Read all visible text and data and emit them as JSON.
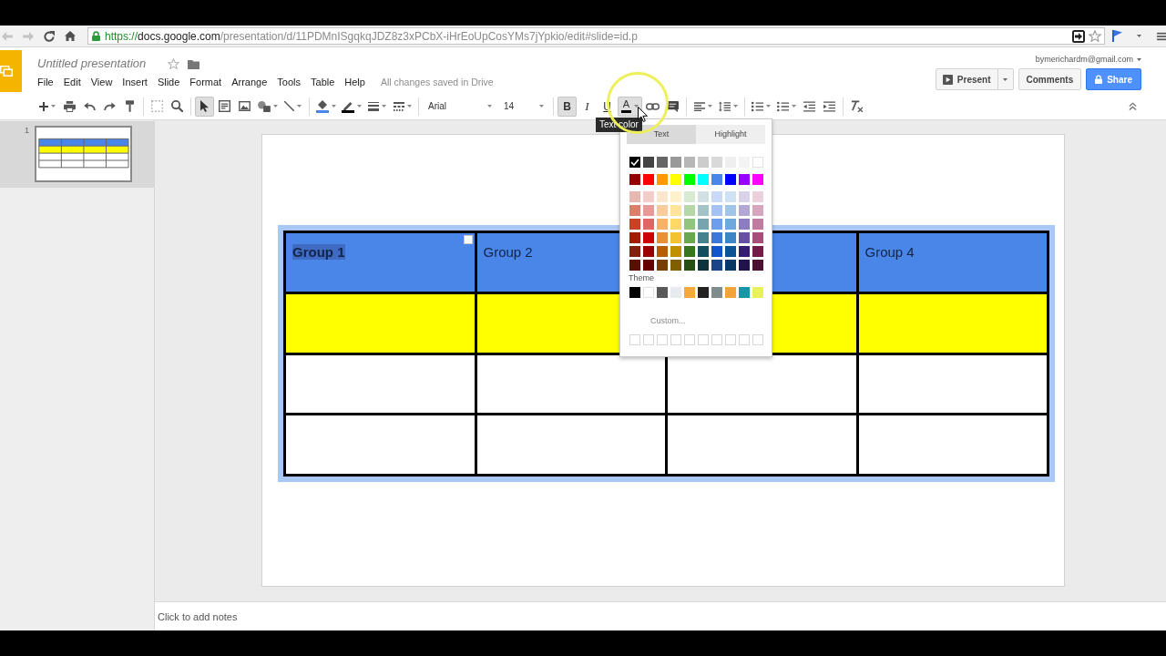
{
  "browser": {
    "nav": [
      {
        "kind": "back",
        "disabled": true
      },
      {
        "kind": "forward",
        "disabled": true
      },
      {
        "kind": "reload",
        "disabled": false
      },
      {
        "kind": "home",
        "disabled": false
      }
    ],
    "url": {
      "scheme": "https://",
      "host": "docs.google.com",
      "path": "/presentation/d/11PDMnISgqkqJDZ8z3xPCbX-iHrEoUpCosYMs7jYpkio/edit#slide=id.p"
    },
    "bookmarked": false
  },
  "app": {
    "title": "Untitled presentation",
    "starred": false,
    "menu": [
      "File",
      "Edit",
      "View",
      "Insert",
      "Slide",
      "Format",
      "Arrange",
      "Tools",
      "Table",
      "Help"
    ],
    "save_status": "All changes saved in Drive",
    "account": "bymerichardm@gmail.com",
    "buttons": [
      {
        "kind": "present",
        "label": "Present"
      },
      {
        "kind": "comments",
        "label": "Comments"
      },
      {
        "kind": "share",
        "label": "Share"
      }
    ]
  },
  "toolbar": {
    "groups": [
      {
        "items": [
          {
            "kind": "new",
            "on": false
          },
          {
            "kind": "print",
            "on": false
          },
          {
            "kind": "undo",
            "on": false
          },
          {
            "kind": "redo",
            "on": false
          },
          {
            "kind": "paint-format",
            "on": false
          }
        ]
      },
      {
        "items": [
          {
            "kind": "zoom-fit",
            "on": false
          },
          {
            "kind": "zoom",
            "on": false
          }
        ]
      },
      {
        "items": [
          {
            "kind": "select",
            "on": true
          },
          {
            "kind": "text-box",
            "on": false
          },
          {
            "kind": "image",
            "on": false
          },
          {
            "kind": "shape",
            "on": false
          },
          {
            "kind": "line",
            "on": false
          }
        ]
      },
      {
        "items": [
          {
            "kind": "fill-color",
            "on": false,
            "color": "#4a86e8"
          },
          {
            "kind": "line-color",
            "on": false,
            "color": "#000000"
          },
          {
            "kind": "line-weight",
            "on": false
          },
          {
            "kind": "line-dash",
            "on": false
          }
        ]
      },
      {
        "items": [
          {
            "kind": "font",
            "value": "Arial"
          },
          {
            "kind": "font-size",
            "value": "14"
          }
        ]
      },
      {
        "items": [
          {
            "kind": "bold",
            "label": "B",
            "on": true
          },
          {
            "kind": "italic",
            "label": "I",
            "on": false
          },
          {
            "kind": "underline",
            "label": "U",
            "on": false
          },
          {
            "kind": "text-color",
            "label": "A",
            "on": true,
            "color": "#000000"
          },
          {
            "kind": "link",
            "on": false
          },
          {
            "kind": "comment",
            "on": false
          }
        ]
      },
      {
        "items": [
          {
            "kind": "align",
            "on": false
          },
          {
            "kind": "line-spacing",
            "on": false
          }
        ]
      },
      {
        "items": [
          {
            "kind": "numbered-list",
            "on": false
          },
          {
            "kind": "bulleted-list",
            "on": false
          },
          {
            "kind": "decrease-indent",
            "on": false
          },
          {
            "kind": "increase-indent",
            "on": false
          }
        ]
      },
      {
        "items": [
          {
            "kind": "clear-formatting",
            "on": false
          }
        ]
      }
    ]
  },
  "tooltip": "Text color",
  "filmstrip": {
    "slides": [
      {
        "number": "1",
        "selected": true
      }
    ]
  },
  "table": {
    "rows": [
      {
        "color": "#4a86e8",
        "cells": [
          {
            "text": "Group 1",
            "bold": true,
            "selected": true
          },
          {
            "text": "Group 2",
            "bold": false,
            "selected": false
          },
          {
            "selected": false
          },
          {
            "text": "Group 4",
            "bold": false,
            "selected": false
          }
        ]
      },
      {
        "color": "#ffff00",
        "cells": [
          {
            "selected": false
          },
          {},
          {
            "selected": false
          },
          {
            "selected": false
          }
        ]
      },
      {
        "color": "#ffffff",
        "cells": [
          {
            "selected": false
          },
          {
            "selected": false
          },
          {
            "selected": false
          },
          {
            "selected": false
          }
        ]
      },
      {
        "color": "#ffffff",
        "cells": [
          {
            "selected": false
          },
          {
            "selected": false
          },
          {
            "selected": false
          },
          {
            "selected": false
          }
        ]
      }
    ]
  },
  "color_picker": {
    "tabs": [
      {
        "label": "Text",
        "selected": true
      },
      {
        "label": "Highlight",
        "selected": false
      }
    ],
    "grid": [
      {
        "swatches": [
          {
            "color": "#000000",
            "selected": true
          },
          {
            "color": "#434343",
            "selected": false
          },
          {
            "color": "#666666",
            "selected": false
          },
          {
            "color": "#999999",
            "selected": false
          },
          {
            "color": "#b7b7b7",
            "selected": false
          },
          {
            "color": "#cccccc",
            "selected": false
          },
          {
            "color": "#d9d9d9",
            "selected": false
          },
          {
            "color": "#efefef",
            "selected": false
          },
          {
            "color": "#f3f3f3",
            "selected": false
          },
          {
            "color": "#ffffff",
            "selected": false
          }
        ]
      },
      {
        "swatches": [
          {
            "color": "#980000",
            "selected": false
          },
          {
            "color": "#ff0000",
            "selected": false
          },
          {
            "color": "#ff9900",
            "selected": false
          },
          {
            "color": "#ffff00",
            "selected": false
          },
          {
            "color": "#00ff00",
            "selected": false
          },
          {
            "color": "#00ffff",
            "selected": false
          },
          {
            "color": "#4a86e8",
            "selected": false
          },
          {
            "color": "#0000ff",
            "selected": false
          },
          {
            "color": "#9900ff",
            "selected": false
          },
          {
            "color": "#ff00ff",
            "selected": false
          }
        ]
      },
      {
        "swatches": [
          {
            "color": "#e6b8af",
            "selected": false
          },
          {
            "color": "#f4cccc",
            "selected": false
          },
          {
            "color": "#fce5cd",
            "selected": false
          },
          {
            "color": "#fff2cc",
            "selected": false
          },
          {
            "color": "#d9ead3",
            "selected": false
          },
          {
            "color": "#d0e0e3",
            "selected": false
          },
          {
            "color": "#c9daf8",
            "selected": false
          },
          {
            "color": "#cfe2f3",
            "selected": false
          },
          {
            "color": "#d9d2e9",
            "selected": false
          },
          {
            "color": "#ead1dc",
            "selected": false
          }
        ]
      },
      {
        "swatches": [
          {
            "color": "#dd7e6b",
            "selected": false
          },
          {
            "color": "#ea9999",
            "selected": false
          },
          {
            "color": "#f9cb9c",
            "selected": false
          },
          {
            "color": "#ffe599",
            "selected": false
          },
          {
            "color": "#b6d7a8",
            "selected": false
          },
          {
            "color": "#a2c4c9",
            "selected": false
          },
          {
            "color": "#a4c2f4",
            "selected": false
          },
          {
            "color": "#9fc5e8",
            "selected": false
          },
          {
            "color": "#b4a7d6",
            "selected": false
          },
          {
            "color": "#d5a6bd",
            "selected": false
          }
        ]
      },
      {
        "swatches": [
          {
            "color": "#cc4125",
            "selected": false
          },
          {
            "color": "#e06666",
            "selected": false
          },
          {
            "color": "#f6b26b",
            "selected": false
          },
          {
            "color": "#ffd966",
            "selected": false
          },
          {
            "color": "#93c47d",
            "selected": false
          },
          {
            "color": "#76a5af",
            "selected": false
          },
          {
            "color": "#6d9eeb",
            "selected": false
          },
          {
            "color": "#6fa8dc",
            "selected": false
          },
          {
            "color": "#8e7cc3",
            "selected": false
          },
          {
            "color": "#c27ba0",
            "selected": false
          }
        ]
      },
      {
        "swatches": [
          {
            "color": "#a61c00",
            "selected": false
          },
          {
            "color": "#cc0000",
            "selected": false
          },
          {
            "color": "#e69138",
            "selected": false
          },
          {
            "color": "#f1c232",
            "selected": false
          },
          {
            "color": "#6aa84f",
            "selected": false
          },
          {
            "color": "#45818e",
            "selected": false
          },
          {
            "color": "#3c78d8",
            "selected": false
          },
          {
            "color": "#3d85c6",
            "selected": false
          },
          {
            "color": "#674ea7",
            "selected": false
          },
          {
            "color": "#a64d79",
            "selected": false
          }
        ]
      },
      {
        "swatches": [
          {
            "color": "#85200c",
            "selected": false
          },
          {
            "color": "#990000",
            "selected": false
          },
          {
            "color": "#b45f06",
            "selected": false
          },
          {
            "color": "#bf9000",
            "selected": false
          },
          {
            "color": "#38761d",
            "selected": false
          },
          {
            "color": "#134f5c",
            "selected": false
          },
          {
            "color": "#1155cc",
            "selected": false
          },
          {
            "color": "#0b5394",
            "selected": false
          },
          {
            "color": "#351c75",
            "selected": false
          },
          {
            "color": "#741b47",
            "selected": false
          }
        ]
      },
      {
        "swatches": [
          {
            "color": "#5b0f00",
            "selected": false
          },
          {
            "color": "#660000",
            "selected": false
          },
          {
            "color": "#783f04",
            "selected": false
          },
          {
            "color": "#7f6000",
            "selected": false
          },
          {
            "color": "#274e13",
            "selected": false
          },
          {
            "color": "#0c343d",
            "selected": false
          },
          {
            "color": "#1c4587",
            "selected": false
          },
          {
            "color": "#073763",
            "selected": false
          },
          {
            "color": "#20124d",
            "selected": false
          },
          {
            "color": "#4c1130",
            "selected": false
          }
        ]
      }
    ],
    "theme": {
      "label": "Theme",
      "swatches": [
        {
          "color": "#000000",
          "selected": false
        },
        {
          "color": "#ffffff",
          "selected": false
        },
        {
          "color": "#595959",
          "selected": false
        },
        {
          "color": "#e7eaee",
          "selected": false
        },
        {
          "color": "#f6a93b",
          "selected": false
        },
        {
          "color": "#222222",
          "selected": false
        },
        {
          "color": "#7f8c8d",
          "selected": false
        },
        {
          "color": "#f4a23a",
          "selected": false
        },
        {
          "color": "#1498a8",
          "selected": false
        },
        {
          "color": "#e9f25a",
          "selected": false
        }
      ]
    },
    "custom": {
      "label": "Custom...",
      "slots": [
        {
          "selected": false
        },
        {
          "selected": false
        },
        {
          "selected": false
        },
        {
          "selected": false
        },
        {
          "selected": false
        },
        {
          "selected": false
        },
        {
          "selected": false
        },
        {
          "selected": false
        },
        {
          "selected": false
        },
        {
          "selected": false
        }
      ]
    }
  },
  "notes": {
    "placeholder": "Click to add notes"
  }
}
